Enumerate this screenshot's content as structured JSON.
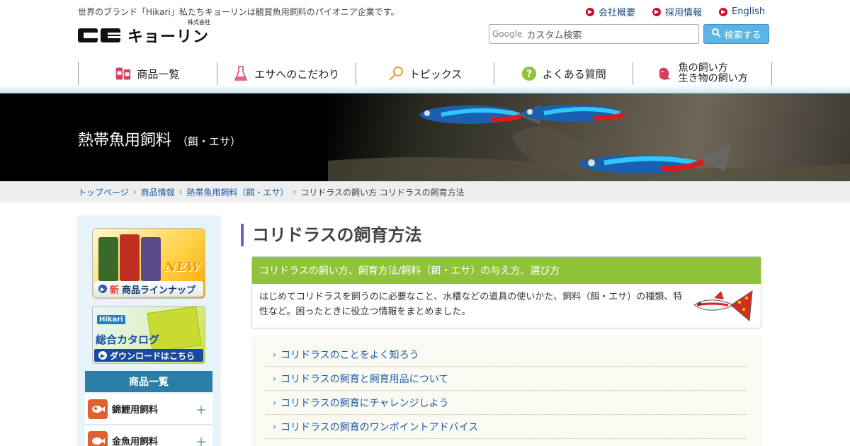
{
  "header": {
    "tagline": "世界のブランド「Hikari」私たちキョーリンは観賞魚用飼料のパイオニア企業です。",
    "logo_text": "キョーリン",
    "logo_sub": "株式会社",
    "top_links": [
      {
        "label": "会社概要"
      },
      {
        "label": "採用情報"
      },
      {
        "label": "English"
      }
    ],
    "search": {
      "brand": "Google",
      "placeholder": "カスタム検索",
      "button_label": "検索する"
    }
  },
  "global_nav": [
    {
      "label": "商品一覧",
      "icon": "products-icon"
    },
    {
      "label": "エサへのこだわり",
      "icon": "flask-icon"
    },
    {
      "label": "トピックス",
      "icon": "pin-icon"
    },
    {
      "label": "よくある質問",
      "icon": "question-icon"
    },
    {
      "label_line1": "魚の飼い方",
      "label_line2": "生き物の飼い方",
      "icon": "fish-icon"
    }
  ],
  "hero": {
    "title": "熱帯魚用飼料",
    "subtitle": "（餌・エサ）"
  },
  "breadcrumb": {
    "items": [
      "トップページ",
      "商品情報",
      "熱帯魚用飼料（餌・エサ）"
    ],
    "current": "コリドラスの飼い方 コリドラスの飼育方法"
  },
  "sidebar": {
    "banner_new": {
      "badge": "NEW",
      "new_char": "新",
      "label": "商品ラインナップ"
    },
    "banner_catalog": {
      "brand": "Hikari",
      "title": "総合カタログ",
      "button": "ダウンロードはこちら"
    },
    "category_heading": "商品一覧",
    "categories": [
      {
        "label": "錦鯉用飼料"
      },
      {
        "label": "金魚用飼料"
      }
    ]
  },
  "content": {
    "page_title": "コリドラスの飼育方法",
    "intro_heading": "コリドラスの飼い方、飼育方法/飼料（餌・エサ）の与え方、選び方",
    "intro_text": "はじめてコリドラスを飼うのに必要なこと、水槽などの道具の使いかた、飼料（餌・エサ）の種類、特性など。困ったときに役立つ情報をまとめました。",
    "links": [
      "コリドラスのことをよく知ろう",
      "コリドラスの飼育と飼育用品について",
      "コリドラスの飼育にチャレンジしよう",
      "コリドラスの飼育のワンポイントアドバイス"
    ]
  },
  "colors": {
    "accent_green": "#8fc33a",
    "title_bar": "#7a5cc8",
    "link_blue": "#1a5ca8",
    "category_head": "#2b7fa6",
    "dot_red": "#c8102e"
  }
}
